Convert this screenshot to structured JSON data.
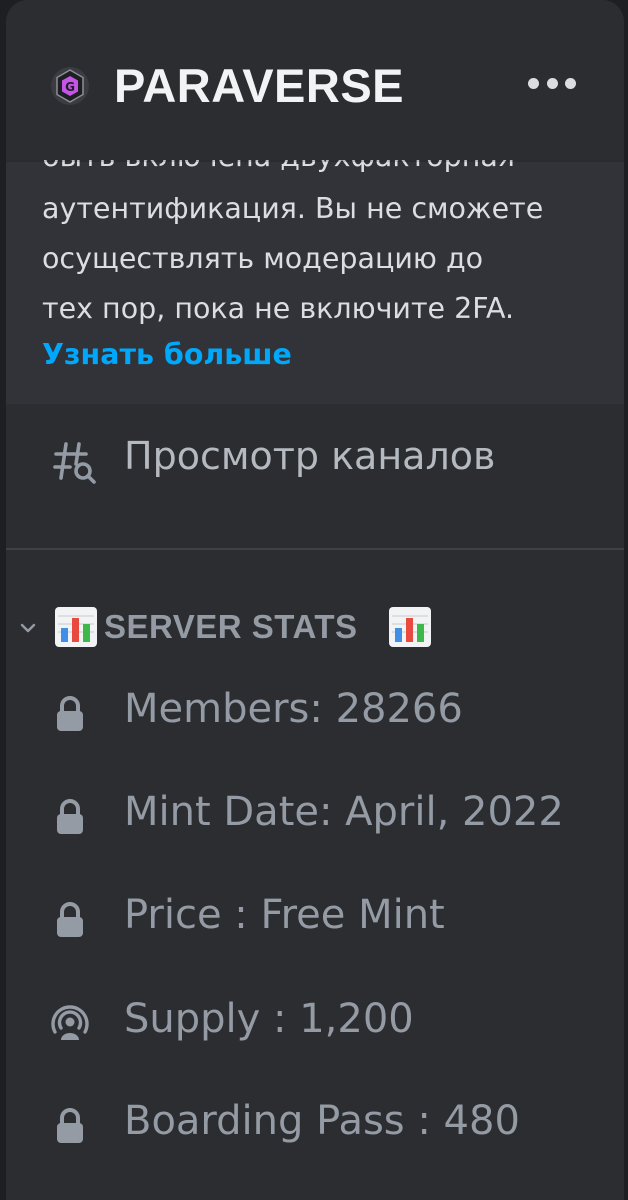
{
  "header": {
    "server_name": "PARAVERSE",
    "server_icon": "paraverse-logo-icon",
    "more_icon": "more-dots-icon"
  },
  "notice": {
    "lines": [
      "быть включена двухфакторная",
      "аутентификация. Вы не сможете",
      "осуществлять модерацию до",
      "тех пор, пока не включите 2FA."
    ],
    "learn_more": "Узнать больше"
  },
  "browse": {
    "label": "Просмотр каналов",
    "icon": "browse-channels-icon"
  },
  "category": {
    "name": "SERVER STATS",
    "icon": "bar-chart-emoji"
  },
  "channels": [
    {
      "label": "Members: 28266",
      "icon": "lock-icon"
    },
    {
      "label": "Mint Date: April, 2022",
      "icon": "lock-icon"
    },
    {
      "label": "Price : Free Mint",
      "icon": "lock-icon"
    },
    {
      "label": "Supply : 1,200",
      "icon": "stage-icon"
    },
    {
      "label": "Boarding Pass :  480",
      "icon": "lock-icon"
    }
  ],
  "colors": {
    "background": "#2b2d31",
    "notice_bg": "#313338",
    "link": "#00a8fc",
    "muted_text": "#949ba4",
    "header_text": "#f2f3f5"
  }
}
